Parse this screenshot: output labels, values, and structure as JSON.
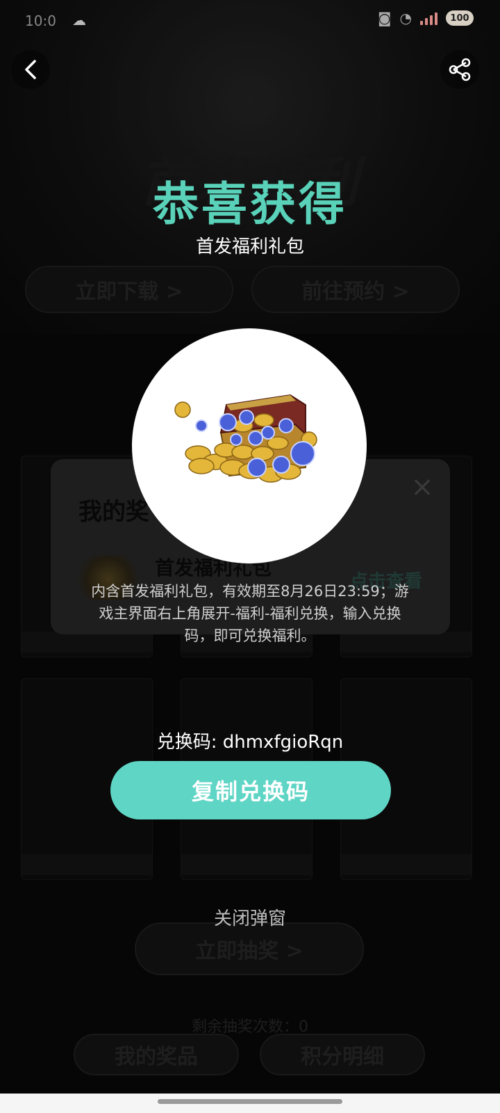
{
  "status_bar": {
    "time": "10:0",
    "battery": "100"
  },
  "background": {
    "banner_title": "首发福利",
    "download_label": "立即下载 >",
    "other_label": "前往预约 >",
    "prize_panel": {
      "title": "我的奖",
      "item_name": "首发福利礼包",
      "view_label": "点击查看"
    },
    "draw_label": "立即抽奖 >",
    "draw_count_text": "剩余抽奖次数：0",
    "my_prizes_label": "我的奖品",
    "points_label": "积分明细"
  },
  "modal": {
    "title": "恭喜获得",
    "subtitle": "首发福利礼包",
    "description": "内含首发福利礼包，有效期至8月26日23:59；游戏主界面右上角展开-福利-福利兑换，输入兑换码，即可兑换福利。",
    "redeem_code_text": "兑换码: dhmxfgioRqn",
    "copy_button_label": "复制兑换码",
    "close_label": "关闭弹窗"
  },
  "colors": {
    "accent": "#59d2b9",
    "button": "#5fd5c5"
  },
  "icons": {
    "back": "chevron-left-icon",
    "share": "share-icon",
    "prize": "treasure-chest-icon"
  }
}
